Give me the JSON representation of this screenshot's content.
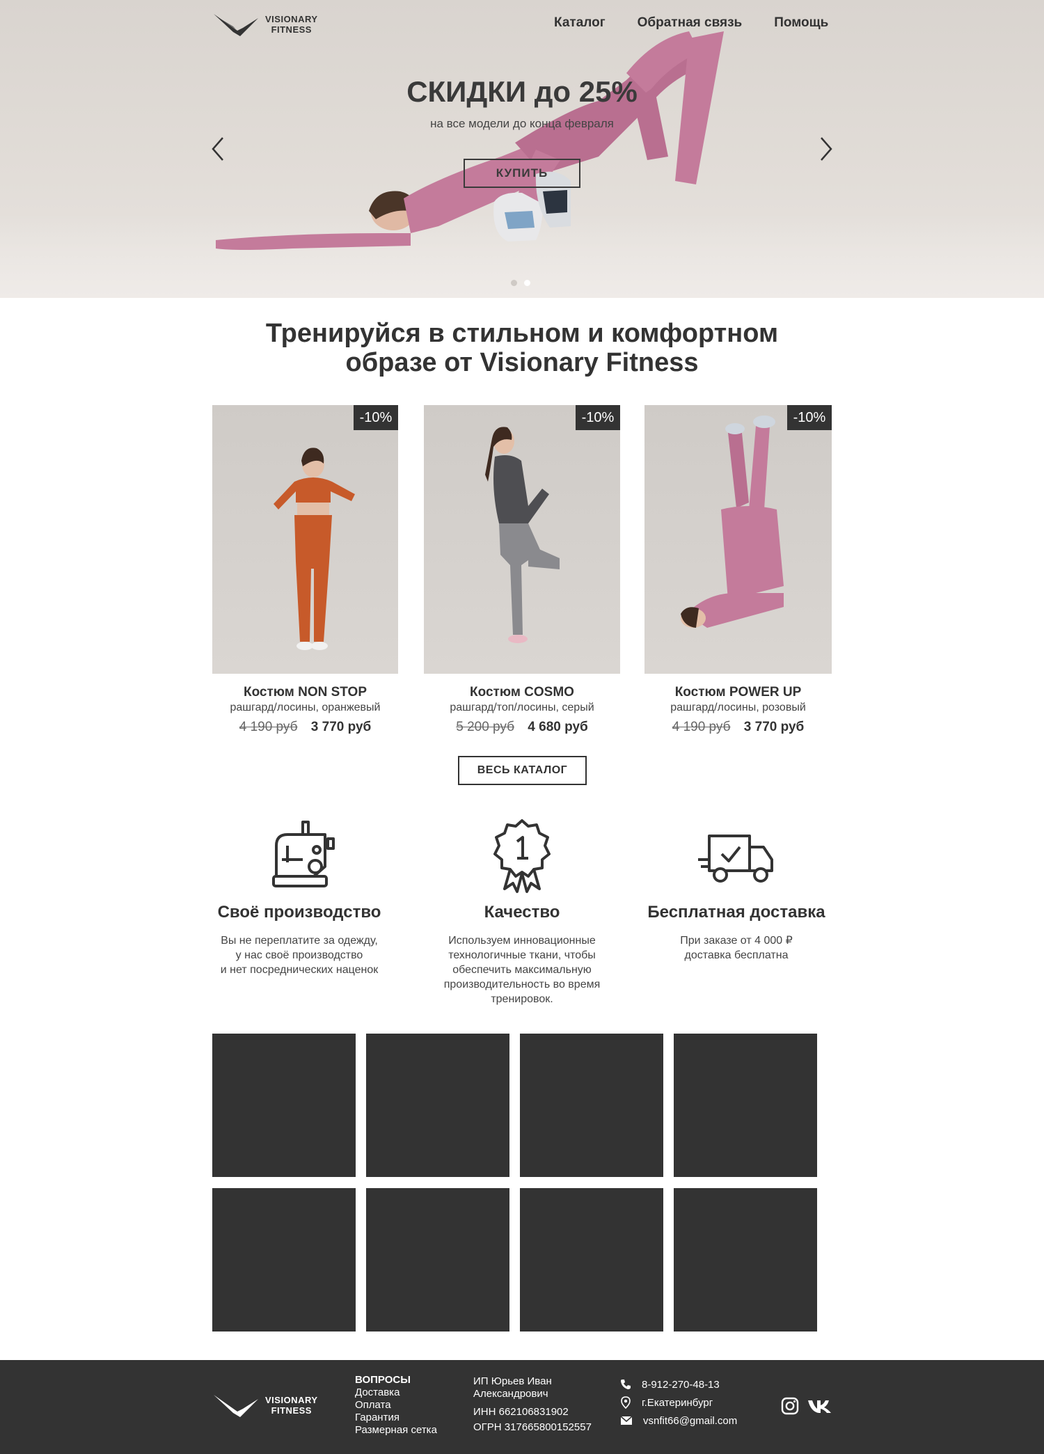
{
  "brand": {
    "line1": "VISIONARY",
    "line2": "FITNESS"
  },
  "nav": [
    {
      "label": "Каталог"
    },
    {
      "label": "Обратная связь"
    },
    {
      "label": "Помощь"
    }
  ],
  "hero": {
    "title": "СКИДКИ до 25%",
    "subtitle": "на все модели до конца февраля",
    "button": "КУПИТЬ",
    "slides_total": 2,
    "active_slide": 2
  },
  "section_title": {
    "line1": "Тренируйся в стильном и комфортном",
    "line2": "образе от Visionary Fitness"
  },
  "products": [
    {
      "badge": "-10%",
      "name": "Костюм NON STOP",
      "desc": "рашгард/лосины, оранжевый",
      "old_price": "4 190 руб",
      "new_price": "3 770 руб",
      "color": "#c75a2a"
    },
    {
      "badge": "-10%",
      "name": "Костюм COSMO",
      "desc": "рашгард/топ/лосины, серый",
      "old_price": "5 200 руб",
      "new_price": "4 680 руб",
      "color": "#6e6e6e"
    },
    {
      "badge": "-10%",
      "name": "Костюм POWER UP",
      "desc": "рашгард/лосины, розовый",
      "old_price": "4 190 руб",
      "new_price": "3 770 руб",
      "color": "#c47b9b"
    }
  ],
  "catalog_button": "ВЕСЬ КАТАЛОГ",
  "features": [
    {
      "icon": "sewing-machine-icon",
      "title": "Своё производство",
      "text": "Вы не переплатите за одежду,\nу нас своё производство\nи нет посреднических наценок"
    },
    {
      "icon": "award-ribbon-icon",
      "title": "Качество",
      "text": "Используем инновационные\nтехнологичные ткани, чтобы\nобеспечить максимальную\nпроизводительность во время\nтренировок."
    },
    {
      "icon": "delivery-truck-icon",
      "title": "Бесплатная доставка",
      "text": "При заказе от 4 000 ₽\nдоставка бесплатна"
    }
  ],
  "footer": {
    "questions": {
      "heading": "ВОПРОСЫ",
      "links": [
        "Доставка",
        "Оплата",
        "Гарантия",
        "Размерная сетка"
      ]
    },
    "legal": {
      "owner_line1": "ИП Юрьев Иван",
      "owner_line2": "Александрович",
      "inn": "ИНН 662106831902",
      "ogrn": "ОГРН 317665800152557"
    },
    "contacts": {
      "phone": "8-912-270-48-13",
      "city": "г.Екатеринбург",
      "email": "vsnfit66@gmail.com"
    }
  },
  "colors": {
    "dark": "#333333",
    "hero_bg": "#dedad6",
    "accent_pink": "#c47b9b"
  }
}
